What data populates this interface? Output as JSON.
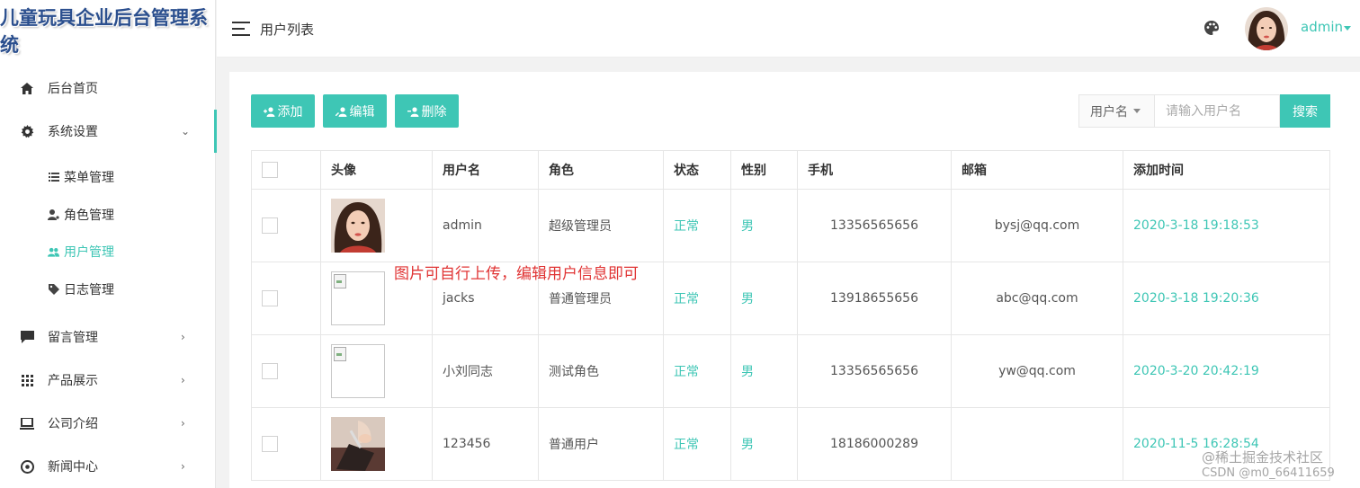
{
  "app": {
    "title": "儿童玩具企业后台管理系统"
  },
  "sidebar": {
    "items": [
      {
        "label": "后台首页",
        "icon": "home-icon",
        "has_arrow": false
      },
      {
        "label": "系统设置",
        "icon": "gear-icon",
        "has_arrow": true,
        "expanded": true
      },
      {
        "label": "留言管理",
        "icon": "message-icon",
        "has_arrow": true
      },
      {
        "label": "产品展示",
        "icon": "grid-icon",
        "has_arrow": true
      },
      {
        "label": "公司介绍",
        "icon": "laptop-icon",
        "has_arrow": true
      },
      {
        "label": "新闻中心",
        "icon": "news-icon",
        "has_arrow": true
      }
    ],
    "sub_items": [
      {
        "label": "菜单管理",
        "icon": "list-icon"
      },
      {
        "label": "角色管理",
        "icon": "user-key-icon"
      },
      {
        "label": "用户管理",
        "icon": "users-icon",
        "active": true
      },
      {
        "label": "日志管理",
        "icon": "tag-icon"
      }
    ]
  },
  "header": {
    "breadcrumb": "用户列表",
    "username": "admin"
  },
  "toolbar": {
    "add_label": "添加",
    "edit_label": "编辑",
    "delete_label": "删除"
  },
  "search": {
    "field_select": "用户名",
    "placeholder": "请输入用户名",
    "button_label": "搜索"
  },
  "table": {
    "columns": [
      "头像",
      "用户名",
      "角色",
      "状态",
      "性别",
      "手机",
      "邮箱",
      "添加时间"
    ],
    "rows": [
      {
        "avatar": "portrait",
        "username": "admin",
        "role": "超级管理员",
        "status": "正常",
        "gender": "男",
        "phone": "13356565656",
        "email": "bysj@qq.com",
        "added": "2020-3-18 19:18:53"
      },
      {
        "avatar": "broken",
        "username": "jacks",
        "role": "普通管理员",
        "status": "正常",
        "gender": "男",
        "phone": "13918655656",
        "email": "abc@qq.com",
        "added": "2020-3-18 19:20:36"
      },
      {
        "avatar": "broken",
        "username": "小刘同志",
        "role": "测试角色",
        "status": "正常",
        "gender": "男",
        "phone": "13356565656",
        "email": "yw@qq.com",
        "added": "2020-3-20 20:42:19"
      },
      {
        "avatar": "writing",
        "username": "123456",
        "role": "普通用户",
        "status": "正常",
        "gender": "男",
        "phone": "18186000289",
        "email": "",
        "added": "2020-11-5 16:28:54"
      }
    ]
  },
  "annotation": "图片可自行上传，编辑用户信息即可",
  "watermark": {
    "line1": "@稀土掘金技术社区",
    "line2": "CSDN @m0_66411659"
  },
  "colors": {
    "accent": "#3ec6b5",
    "annotation": "#e03434",
    "logo": "#2b4f8e"
  }
}
